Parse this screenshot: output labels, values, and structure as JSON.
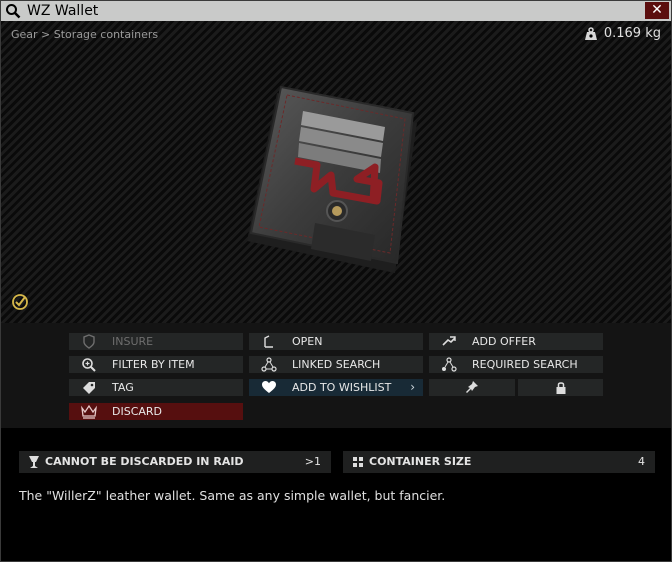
{
  "window": {
    "title": "WZ Wallet",
    "close_glyph": "✕",
    "breadcrumb": "Gear > Storage containers",
    "weight": "0.169 kg"
  },
  "actions": {
    "insure": "INSURE",
    "open": "OPEN",
    "add_offer": "ADD OFFER",
    "filter_by_item": "FILTER BY ITEM",
    "linked_search": "LINKED SEARCH",
    "required_search": "REQUIRED SEARCH",
    "tag": "TAG",
    "add_to_wishlist": "ADD TO WISHLIST",
    "wishlist_chevron": "›",
    "discard": "DISCARD"
  },
  "properties": [
    {
      "label": "CANNOT BE DISCARDED IN RAID",
      "value": ">1",
      "icon": "goblet-icon"
    },
    {
      "label": "CONTAINER SIZE",
      "value": "4",
      "icon": "grid-icon"
    }
  ],
  "description": "The \"WillerZ\" leather wallet. Same as any simple wallet, but fancier.",
  "colors": {
    "titlebar": "#c9cac9",
    "close": "#5b0e0e",
    "wishlist": "#182a36",
    "discard": "#560f0f",
    "check": "#d6b84a",
    "wallet_red": "#8e1f24"
  }
}
